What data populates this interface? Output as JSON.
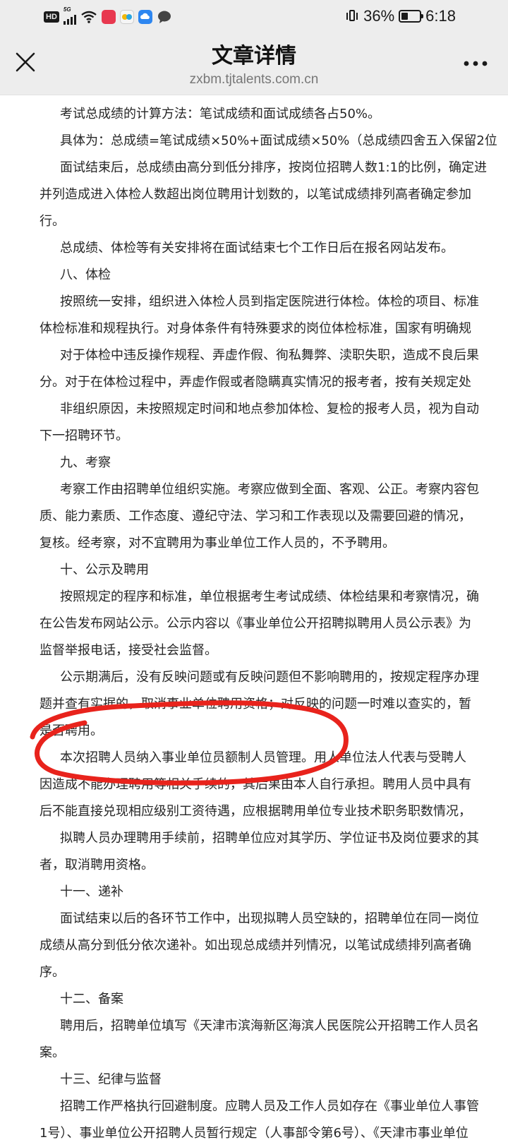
{
  "status_bar": {
    "network_badge": "HD",
    "signal_type": "5G",
    "battery_text": "36%",
    "battery_level": 0.36,
    "time": "6:18",
    "icons": [
      "signal-icon",
      "wifi-icon",
      "app-notification-icons",
      "chat-icon",
      "vibrate-icon",
      "battery-icon"
    ]
  },
  "header": {
    "title": "文章详情",
    "url": "zxbm.tjtalents.com.cn",
    "close_icon": "close-icon",
    "more_icon": "more-options-icon"
  },
  "article": {
    "lines": [
      {
        "text": "考试总成绩的计算方法：笔试成绩和面试成绩各占50%。",
        "indent": true
      },
      {
        "text": "具体为：总成绩=笔试成绩×50%+面试成绩×50%（总成绩四舍五入保留2位",
        "indent": true
      },
      {
        "text": "面试结束后，总成绩由高分到低分排序，按岗位招聘人数1:1的比例，确定进",
        "indent": true
      },
      {
        "text": "并列造成进入体检人数超出岗位聘用计划数的，以笔试成绩排列高者确定参加",
        "indent": false
      },
      {
        "text": "行。",
        "indent": false
      },
      {
        "text": "总成绩、体检等有关安排将在面试结束七个工作日后在报名网站发布。",
        "indent": true
      },
      {
        "text": "八、体检",
        "indent": true
      },
      {
        "text": "按照统一安排，组织进入体检人员到指定医院进行体检。体检的项目、标准",
        "indent": true
      },
      {
        "text": "体检标准和规程执行。对身体条件有特殊要求的岗位体检标准，国家有明确规",
        "indent": false
      },
      {
        "text": "对于体检中违反操作规程、弄虚作假、徇私舞弊、渎职失职，造成不良后果",
        "indent": true
      },
      {
        "text": "分。对于在体检过程中，弄虚作假或者隐瞒真实情况的报考者，按有关规定处",
        "indent": false
      },
      {
        "text": "非组织原因，未按照规定时间和地点参加体检、复检的报考人员，视为自动",
        "indent": true
      },
      {
        "text": "下一招聘环节。",
        "indent": false
      },
      {
        "text": "九、考察",
        "indent": true
      },
      {
        "text": "考察工作由招聘单位组织实施。考察应做到全面、客观、公正。考察内容包",
        "indent": true
      },
      {
        "text": "质、能力素质、工作态度、遵纪守法、学习和工作表现以及需要回避的情况，",
        "indent": false
      },
      {
        "text": "复核。经考察，对不宜聘用为事业单位工作人员的，不予聘用。",
        "indent": false
      },
      {
        "text": "十、公示及聘用",
        "indent": true
      },
      {
        "text": "按照规定的程序和标准，单位根据考生考试成绩、体检结果和考察情况，确",
        "indent": true
      },
      {
        "text": "在公告发布网站公示。公示内容以《事业单位公开招聘拟聘用人员公示表》为",
        "indent": false
      },
      {
        "text": "监督举报电话，接受社会监督。",
        "indent": false
      },
      {
        "text": "公示期满后，没有反映问题或有反映问题但不影响聘用的，按规定程序办理",
        "indent": true
      },
      {
        "text": "题并查有实据的，取消事业单位聘用资格；对反映的问题一时难以查实的，暂",
        "indent": false
      },
      {
        "text": "是否聘用。",
        "indent": false
      },
      {
        "text": "本次招聘人员纳入事业单位员额制人员管理。用人单位法人代表与受聘人",
        "indent": true
      },
      {
        "text": "因造成不能办理聘用等相关手续的，其后果由本人自行承担。聘用人员中具有",
        "indent": false
      },
      {
        "text": "后不能直接兑现相应级别工资待遇，应根据聘用单位专业技术职务职数情况，",
        "indent": false
      },
      {
        "text": "拟聘人员办理聘用手续前，招聘单位应对其学历、学位证书及岗位要求的其",
        "indent": true
      },
      {
        "text": "者，取消聘用资格。",
        "indent": false
      },
      {
        "text": "十一、递补",
        "indent": true
      },
      {
        "text": "面试结束以后的各环节工作中，出现拟聘人员空缺的，招聘单位在同一岗位",
        "indent": true
      },
      {
        "text": "成绩从高分到低分依次递补。如出现总成绩并列情况，以笔试成绩排列高者确",
        "indent": false
      },
      {
        "text": "序。",
        "indent": false
      },
      {
        "text": "十二、备案",
        "indent": true
      },
      {
        "text": "聘用后，招聘单位填写《天津市滨海新区海滨人民医院公开招聘工作人员名",
        "indent": true
      },
      {
        "text": "案。",
        "indent": false
      },
      {
        "text": "十三、纪律与监督",
        "indent": true
      },
      {
        "text": "招聘工作严格执行回避制度。应聘人员及工作人员如存在《事业单位人事管",
        "indent": true
      },
      {
        "text": "1号）、事业单位公开招聘人员暂行规定（人事部令第6号）、《天津市事业单位",
        "indent": false
      }
    ]
  },
  "annotation": {
    "type": "hand-drawn-circle",
    "color": "#e8231c"
  }
}
